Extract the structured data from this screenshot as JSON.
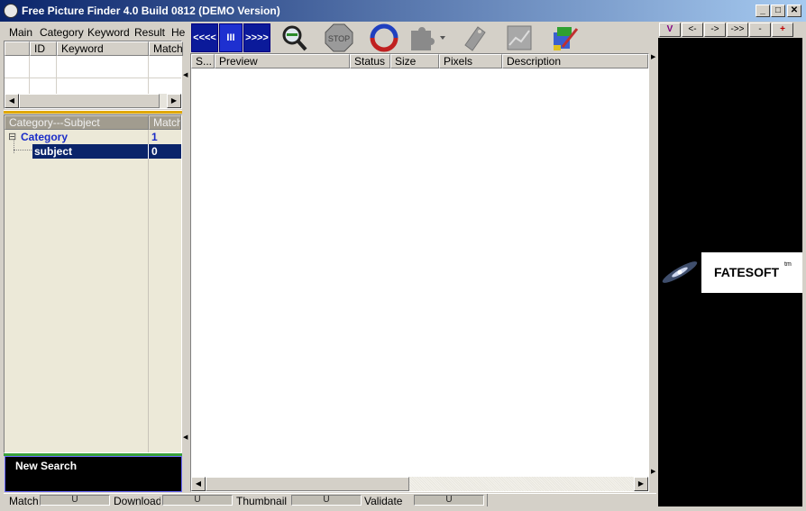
{
  "window": {
    "title": "Free Picture Finder 4.0 Build 0812  (DEMO Version)",
    "min_glyph": "_",
    "max_glyph": "□",
    "close_glyph": "✕"
  },
  "menu": [
    "Main",
    "Category",
    "Keyword",
    "Result",
    "He"
  ],
  "keyword_table": {
    "columns": [
      "ID",
      "Keyword",
      "Match"
    ]
  },
  "category_tree": {
    "columns": [
      "Category---Subject",
      "Match"
    ],
    "rows": [
      {
        "expander": "⊟",
        "label": "Category",
        "match": "1"
      },
      {
        "expander": "",
        "label": "subject",
        "match": "0"
      }
    ]
  },
  "new_search_label": "New Search",
  "toolbar": {
    "back_label": "<<<<",
    "pause_label": "III",
    "forward_label": ">>>>",
    "stop_label": "STOP"
  },
  "results_table": {
    "columns": [
      "S...",
      "Preview",
      "Status",
      "Size",
      "Pixels",
      "Description"
    ]
  },
  "right_panel": {
    "buttons": [
      "V",
      "<-",
      "->",
      "->>",
      "-",
      "+"
    ],
    "brand": "FATESOFT",
    "brand_sup": "tm"
  },
  "statusbar": [
    {
      "label": "Match",
      "value": "U"
    },
    {
      "label": "Download",
      "value": "U"
    },
    {
      "label": "Thumbnail",
      "value": "U"
    },
    {
      "label": "Validate",
      "value": "U"
    }
  ],
  "colors": {
    "title_start": "#0a246a",
    "title_end": "#a6caf0",
    "toolbar_blue": "#0b1a9a",
    "selection": "#0a246a",
    "panel_black": "#000000"
  }
}
